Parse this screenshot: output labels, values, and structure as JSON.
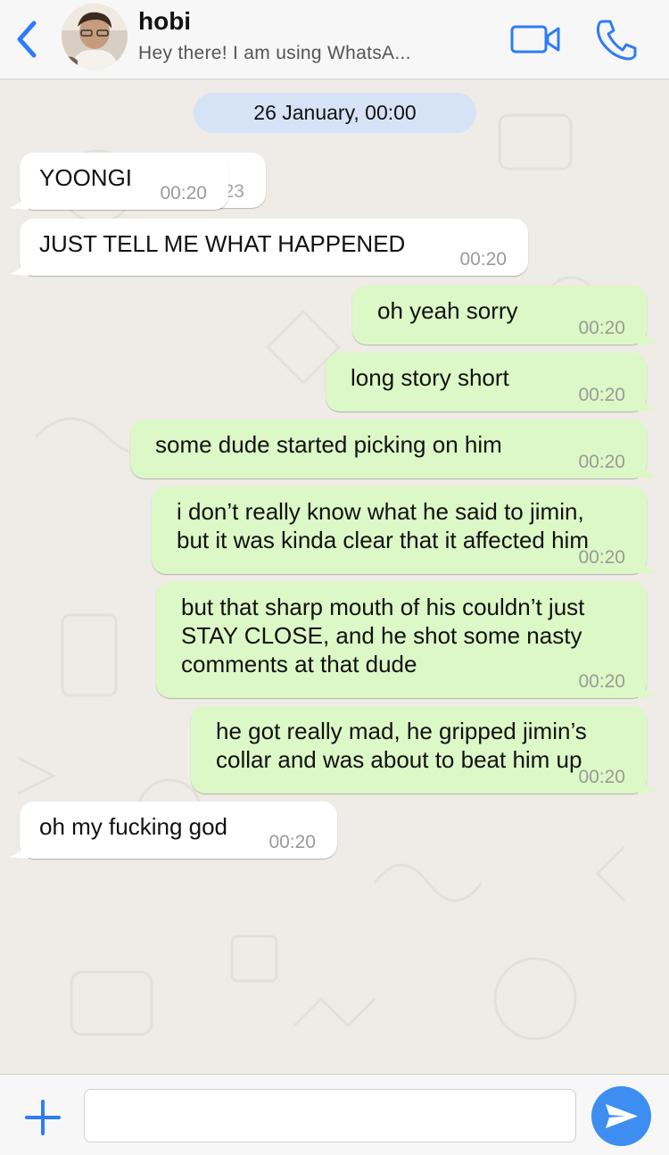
{
  "header": {
    "back_icon": "chevron-left-icon",
    "contact_name": "hobi",
    "contact_status": "Hey there! I am using WhatsA...",
    "video_icon": "video-camera-icon",
    "call_icon": "phone-icon",
    "accent": "#2e7cf6"
  },
  "chat": {
    "date_label": "26 January, 00:00",
    "behind_time": "00:23",
    "messages": [
      {
        "dir": "in",
        "text": "YOONGI",
        "time": "00:20"
      },
      {
        "dir": "in",
        "text": "JUST TELL ME WHAT HAPPENED",
        "time": "00:20"
      },
      {
        "dir": "out",
        "text": "oh yeah sorry",
        "time": "00:20"
      },
      {
        "dir": "out",
        "text": "long story short",
        "time": "00:20"
      },
      {
        "dir": "out",
        "text": "some dude started picking on him",
        "time": "00:20"
      },
      {
        "dir": "out",
        "lines": [
          "i don’t really know what he said to jimin,",
          "but it was kinda clear that it affected him"
        ],
        "time": "00:20"
      },
      {
        "dir": "out",
        "lines": [
          "but that sharp mouth of his couldn’t just",
          "STAY CLOSE, and he shot some nasty",
          "comments at that dude"
        ],
        "time": "00:20"
      },
      {
        "dir": "out",
        "lines": [
          "he got really mad, he gripped jimin’s",
          "collar and was about to beat him up"
        ],
        "time": "00:20"
      },
      {
        "dir": "in",
        "text": "oh my fucking god",
        "time": "00:20"
      }
    ],
    "colors": {
      "incoming": "#ffffff",
      "outgoing": "#dcf8c6",
      "date_pill": "#d6e3f6"
    }
  },
  "composer": {
    "plus_icon": "plus-icon",
    "input_value": "",
    "input_placeholder": "",
    "send_icon": "send-icon",
    "send_color": "#3d8ef0"
  }
}
